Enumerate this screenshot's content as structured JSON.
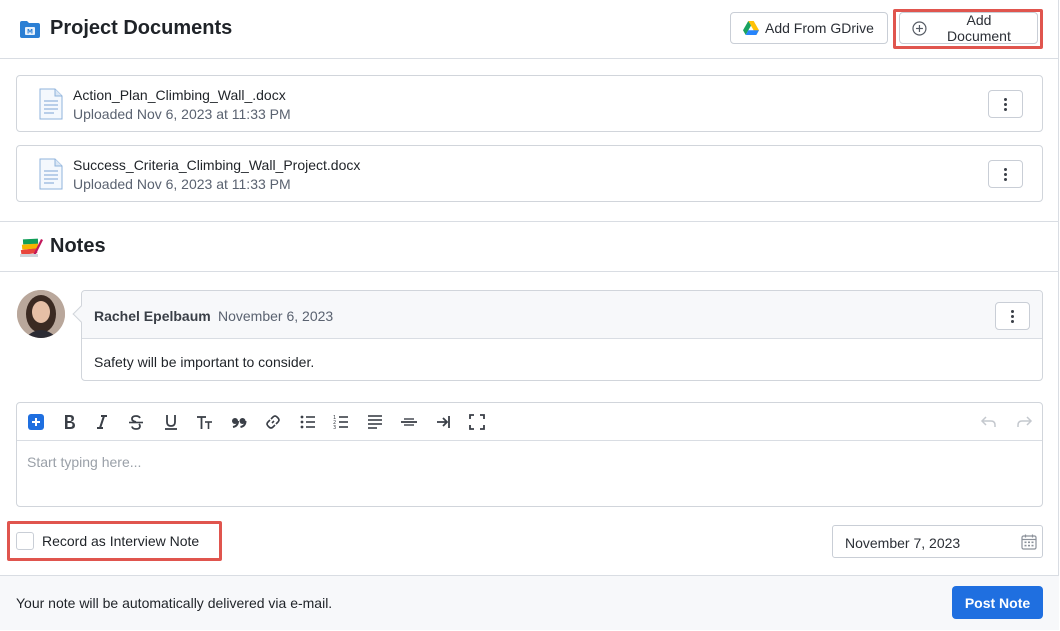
{
  "documents": {
    "title": "Project Documents",
    "folder_icon": "folder-icon",
    "add_gdrive_label": "Add From GDrive",
    "add_document_label": "Add Document",
    "files": [
      {
        "name": "Action_Plan_Climbing_Wall_.docx",
        "uploaded": "Uploaded Nov 6, 2023 at 11:33 PM"
      },
      {
        "name": "Success_Criteria_Climbing_Wall_Project.docx",
        "uploaded": "Uploaded Nov 6, 2023 at 11:33 PM"
      }
    ]
  },
  "notes": {
    "title": "Notes",
    "entries": [
      {
        "author": "Rachel Epelbaum",
        "date": "November 6, 2023",
        "body": "Safety will be important to consider."
      }
    ],
    "editor": {
      "placeholder": "Start typing here...",
      "toolbar": [
        "add",
        "bold",
        "italic",
        "strikethrough",
        "underline",
        "text-size",
        "quote",
        "link",
        "bullet-list",
        "numbered-list",
        "align",
        "horizontal-rule",
        "indent",
        "fullscreen",
        "undo",
        "redo"
      ]
    },
    "record_interview_label": "Record as Interview Note",
    "record_interview_checked": false,
    "note_date": "November 7, 2023"
  },
  "footer": {
    "delivery_text": "Your note will be automatically delivered via e-mail.",
    "post_label": "Post Note"
  },
  "colors": {
    "primary": "#1f6fe0",
    "highlight": "#e0554e",
    "border": "#d1d5db"
  }
}
